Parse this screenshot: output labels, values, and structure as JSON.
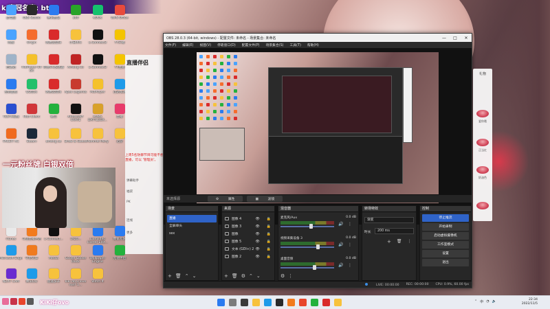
{
  "stream_overlay": {
    "banner_text": "ki家冠名真: btw",
    "fan_slogan": "一元粉丝牌 白银双倍",
    "side_panel_title": "直播伴侣",
    "side_panel_rows": [
      "弹幕助手",
      "福袋",
      "PK",
      "连线",
      "更多"
    ],
    "tip_text": "上周5名防御节目可能不想直播，可以 '管理员'。"
  },
  "desktop_icons": [
    {
      "label": "此电脑",
      "color": "#4aa3ff"
    },
    {
      "label": "OBS Studio",
      "color": "#2a2a2a"
    },
    {
      "label": "腾讯会议",
      "color": "#2a7bf0"
    },
    {
      "label": "360",
      "color": "#29a329"
    },
    {
      "label": "KOOK",
      "color": "#14c16d"
    },
    {
      "label": "WPS Office",
      "color": "#e84a3c"
    },
    {
      "label": "网络",
      "color": "#4aa3ff"
    },
    {
      "label": "Origin",
      "color": "#f56c2d"
    },
    {
      "label": "网易云音乐",
      "color": "#d92b2b"
    },
    {
      "label": "小白001",
      "color": "#f7c23c"
    },
    {
      "label": "L-Connect3",
      "color": "#111111"
    },
    {
      "label": "YY开播",
      "color": "#f4c400"
    },
    {
      "label": "回收站",
      "color": "#9fb3c8"
    },
    {
      "label": "PotPlayer 64 bit",
      "color": "#f5c12b"
    },
    {
      "label": "网易UU加速器",
      "color": "#d92b2b"
    },
    {
      "label": "Among Us",
      "color": "#c02424"
    },
    {
      "label": "L-Connect3",
      "color": "#111111"
    },
    {
      "label": "YY直播",
      "color": "#f4c400"
    },
    {
      "label": "控制面板",
      "color": "#2a7bf0"
    },
    {
      "label": "QQ音乐",
      "color": "#24c06b"
    },
    {
      "label": "网易云音乐",
      "color": "#d92b2b"
    },
    {
      "label": "Apex Legends",
      "color": "#c83a2e"
    },
    {
      "label": "PotPlayer",
      "color": "#f5c12b"
    },
    {
      "label": "迅游加速",
      "color": "#1e9be9"
    },
    {
      "label": "TESTS在线",
      "color": "#2a4fd0"
    },
    {
      "label": "Riot Client",
      "color": "#d13639"
    },
    {
      "label": "微信",
      "color": "#24b13d"
    },
    {
      "label": "ARMOURY CRATE",
      "color": "#111111"
    },
    {
      "label": "PUBG BATTLEGR...",
      "color": "#d9a12b"
    },
    {
      "label": "直播",
      "color": "#e83b6b"
    },
    {
      "label": "FACEIT AC",
      "color": "#f06a1e"
    },
    {
      "label": "Steam",
      "color": "#1b2838"
    },
    {
      "label": "among us",
      "color": "#f7c23c"
    },
    {
      "label": "Draw & Guess",
      "color": "#f7c23c"
    },
    {
      "label": "Pummel Party",
      "color": "#f7c23c"
    },
    {
      "label": "迅游",
      "color": "#f7c23c"
    },
    {
      "label": "iTunes",
      "color": "#e9e9e9"
    },
    {
      "label": "斗鱼直播伴侣",
      "color": "#f27b1e"
    },
    {
      "label": "L-Connect...",
      "color": "#111111"
    },
    {
      "label": "1920...",
      "color": "#f7c23c"
    },
    {
      "label": "LiveVideo Hoster Edit...",
      "color": "#2a7bf0"
    },
    {
      "label": "数据有限",
      "color": "#2a7bf0"
    },
    {
      "label": "Microsoft Edge",
      "color": "#1e9be9"
    },
    {
      "label": "守望先锋",
      "color": "#f07a1e"
    },
    {
      "label": "Media",
      "color": "#f7c23c"
    },
    {
      "label": "Goose Goose Duck",
      "color": "#f7c23c"
    },
    {
      "label": "Wallpaper Engine",
      "color": "#2a7bf0"
    },
    {
      "label": "无他伴侣",
      "color": "#24b13d"
    },
    {
      "label": "NZXT CAM",
      "color": "#6a2bd0"
    },
    {
      "label": "腾讯QQ",
      "color": "#1e9be9"
    },
    {
      "label": "逍遥多开",
      "color": "#f7c23c"
    },
    {
      "label": "kiki do u love me? 1...",
      "color": "#f7c23c"
    },
    {
      "label": "Witch It",
      "color": "#f7c23c"
    }
  ],
  "obs": {
    "title": "OBS 28.0.3 (64-bit, windows) - 配置文件: 未命名 - 场景集合: 未命名",
    "window_controls": [
      "—",
      "□",
      "✕"
    ],
    "menu": [
      "文件(F)",
      "编辑(E)",
      "视图(V)",
      "停靠窗口(D)",
      "配置文件(P)",
      "场景集合(S)",
      "工具(T)",
      "帮助(H)"
    ],
    "source_toolbar": {
      "label": "未选择源",
      "properties": "属性",
      "filters": "滤镜"
    },
    "scenes": {
      "header": "场景",
      "items": [
        "直播",
        "全屏单头",
        "sex"
      ],
      "selected_index": 0
    },
    "sources": {
      "header": "来源",
      "items": [
        "图像 4",
        "图像 3",
        "图像",
        "图像 5",
        "文本 (GDI+) 2",
        "图像 2"
      ]
    },
    "mixer": {
      "header": "混音器",
      "channels": [
        {
          "name": "麦克风/Aux",
          "db": "0.0 dB",
          "level": 0.55
        },
        {
          "name": "视频采集设备 3",
          "db": "0.0 dB",
          "level": 0.68
        },
        {
          "name": "桌面音频",
          "db": "0.0 dB",
          "level": 0.62
        }
      ]
    },
    "transitions": {
      "header": "转场特效",
      "selected": "渐变",
      "duration_label": "时长",
      "duration_value": "200 ms"
    },
    "controls": {
      "header": "控制",
      "buttons": [
        "停止推流",
        "开始录制",
        "启动虚拟摄像机",
        "工作室模式",
        "设置",
        "退出"
      ]
    },
    "status": {
      "live": "LIVE: 00:00:00",
      "rec": "REC: 00:00:00",
      "cpu": "CPU: 0.9%, 60.00 fps"
    }
  },
  "gift_panel": {
    "title": "礼物",
    "items": [
      "爱你哦",
      "正当红",
      "奶油色"
    ]
  },
  "taskbar": {
    "username": "KiKi仔ovo",
    "time": "22:34",
    "date": "2022/11/5",
    "tray_text": "中"
  }
}
